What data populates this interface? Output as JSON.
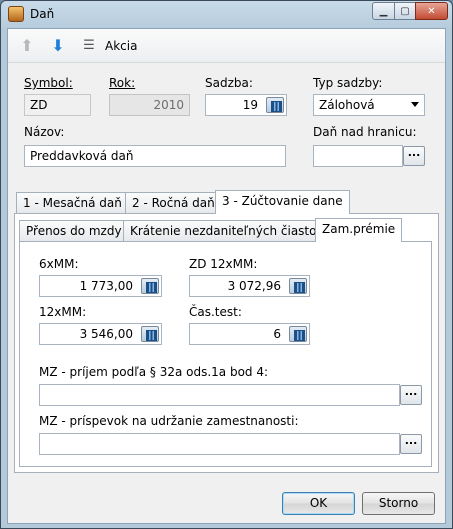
{
  "window": {
    "title": "Daň"
  },
  "toolbar": {
    "action_label": "Akcia"
  },
  "form": {
    "symbol_label": "Symbol:",
    "symbol_value": "ZD",
    "rok_label": "Rok:",
    "rok_value": "2010",
    "sadzba_label": "Sadzba:",
    "sadzba_value": "19",
    "typ_label": "Typ sadzby:",
    "typ_value": "Zálohová",
    "nazov_label": "Názov:",
    "nazov_value": "Preddavková daň",
    "dan_nad_label": "Daň nad hranicu:",
    "dan_nad_value": ""
  },
  "tabs": [
    "1 - Mesačná daň",
    "2 - Ročná daň",
    "3 - Zúčtovanie dane"
  ],
  "subtabs": [
    "Přenos do mzdy",
    "Krátenie nezdaniteľných čiastok",
    "Zam.prémie"
  ],
  "zam": {
    "mm6_label": "6xMM:",
    "mm6_value": "1 773,00",
    "zd12_label": "ZD 12xMM:",
    "zd12_value": "3 072,96",
    "mm12_label": "12xMM:",
    "mm12_value": "3 546,00",
    "cas_label": "Čas.test:",
    "cas_value": "6",
    "prijem_label": "MZ - príjem podľa § 32a ods.1a bod 4:",
    "prijem_value": "",
    "prispevok_label": "MZ - príspevok na udržanie zamestnanosti:",
    "prispevok_value": ""
  },
  "buttons": {
    "ok": "OK",
    "storno": "Storno"
  }
}
